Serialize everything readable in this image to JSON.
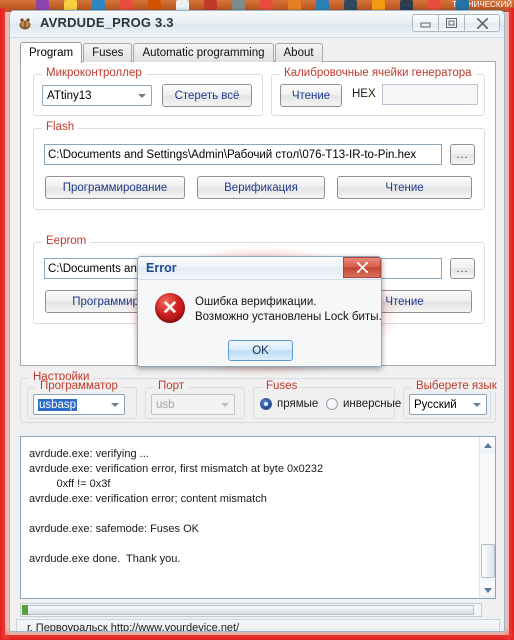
{
  "taskbar": {
    "label": "ТЕХНИЧЕСКИЙ",
    "icon_colors": [
      "#8e44ad",
      "#f4d03f",
      "#2e86c1",
      "#e74c3c",
      "#d35400",
      "#ecf0f1",
      "#c0392b",
      "#7f8c8d",
      "#e74c3c",
      "#e67e22",
      "#2980b9",
      "#34495e",
      "#f39c12",
      "#2c3e50",
      "#e74c3c",
      "#2471a3"
    ]
  },
  "window": {
    "title": "AVRDUDE_PROG 3.3",
    "icon_name": "app-bug-icon",
    "minimize_glyph": "▭",
    "maximize_glyph": "❐",
    "close_glyph": "✕"
  },
  "tabs": [
    {
      "label": "Program",
      "active": true
    },
    {
      "label": "Fuses",
      "active": false
    },
    {
      "label": "Automatic programming",
      "active": false
    },
    {
      "label": "About",
      "active": false
    }
  ],
  "mcu_group": {
    "title": "Микроконтроллер",
    "combo_value": "ATtiny13",
    "erase_button": "Стереть всё"
  },
  "calibration_group": {
    "title": "Калибровочные ячейки генератора",
    "read_button": "Чтение",
    "hex_label": "HEX",
    "hex_value": ""
  },
  "flash_group": {
    "title": "Flash",
    "path": "C:\\Documents and Settings\\Admin\\Рабочий стол\\076-T13-IR-to-Pin.hex",
    "browse_button": "...",
    "program_button": "Программирование",
    "verify_button": "Верификация",
    "read_button": "Чтение"
  },
  "eeprom_group": {
    "title": "Eeprom",
    "path": "C:\\Documents and S",
    "browse_button": "...",
    "program_button": "Программирова",
    "verify_button": "",
    "read_button": "Чтение"
  },
  "settings_group": {
    "title": "Настройки",
    "programmer": {
      "title": "Программатор",
      "value": "usbasp"
    },
    "port": {
      "title": "Порт",
      "value": "usb",
      "disabled": true
    },
    "fuses": {
      "title": "Fuses",
      "options": [
        {
          "label": "прямые",
          "checked": true
        },
        {
          "label": "инверсные",
          "checked": false
        }
      ]
    },
    "language": {
      "title": "Выберете язык",
      "value": "Русский"
    }
  },
  "log": {
    "text": "avrdude.exe: verifying ...\navrdude.exe: verification error, first mismatch at byte 0x0232\n         0xff != 0x3f\navrdude.exe: verification error; content mismatch\n\navrdude.exe: safemode: Fuses OK\n\navrdude.exe done.  Thank you."
  },
  "statusbar": {
    "text": "г. Первоуральск   http://www.yourdevice.net/"
  },
  "dialog": {
    "title": "Error",
    "close_glyph": "✕",
    "icon_name": "error-x-icon",
    "icon_glyph": "✕",
    "message": "Ошибка верификации.\nВозможно установлены Lock биты.",
    "ok_button": "OK"
  },
  "colors": {
    "group_title": "#c0392b",
    "button_text": "#203a8f",
    "dialog_title": "#1c4b8f",
    "error_red": "#d32020",
    "glow_red": "#e02020",
    "selection_blue": "#2a6ec9"
  }
}
